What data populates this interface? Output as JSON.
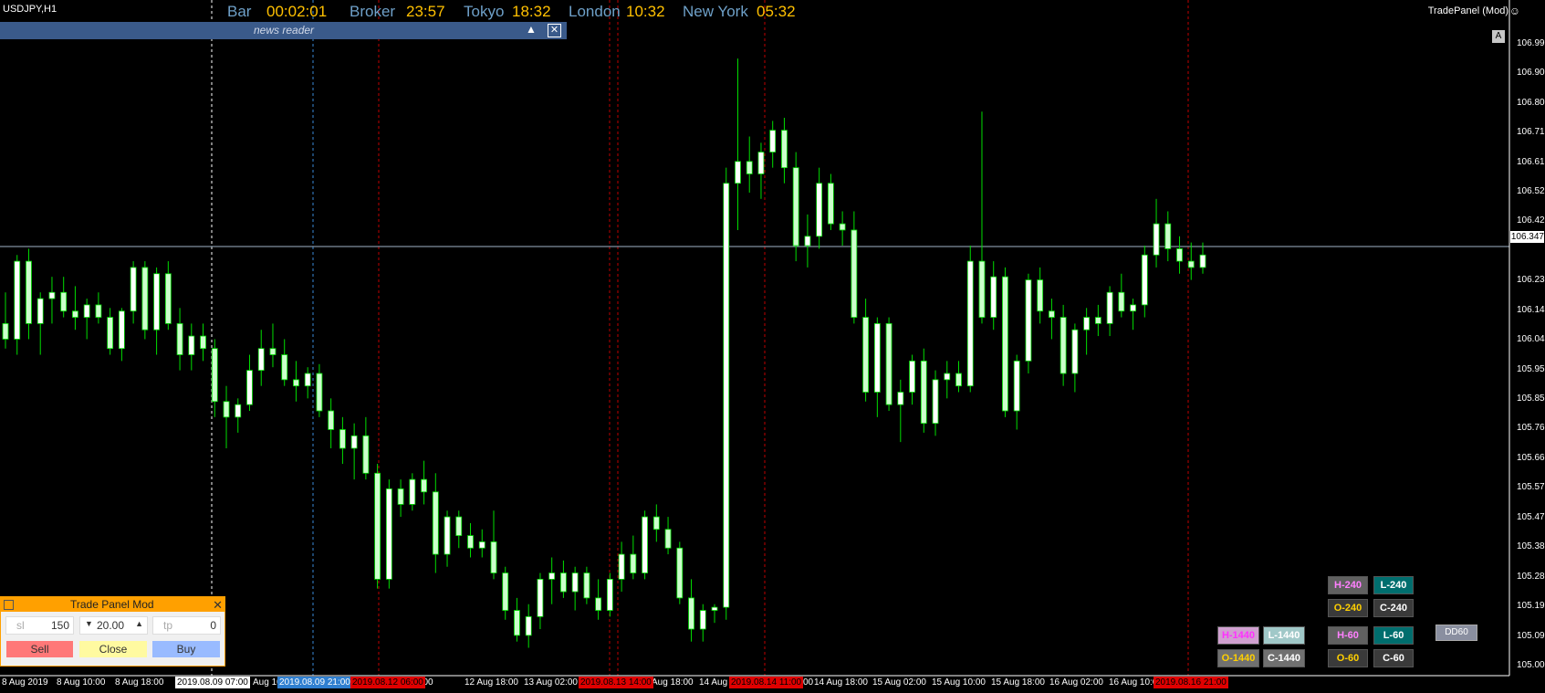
{
  "window": {
    "symbol": "USDJPY,H1"
  },
  "clock": {
    "bar_label": "Bar",
    "bar_value": "00:02:01",
    "broker_label": "Broker",
    "broker_value": "23:57",
    "tokyo_label": "Tokyo",
    "tokyo_value": "18:32",
    "london_label": "London",
    "london_value": "10:32",
    "newyork_label": "New York",
    "newyork_value": "05:32"
  },
  "indicator_title": "TradePanel (Mod)",
  "autoscroll_label": "A",
  "news_reader": {
    "title": "news reader"
  },
  "price_axis": {
    "labels": [
      "106.995",
      "106.900",
      "106.805",
      "106.710",
      "106.615",
      "106.520",
      "106.425",
      "106.235",
      "106.140",
      "106.045",
      "105.950",
      "105.855",
      "105.760",
      "105.665",
      "105.570",
      "105.475",
      "105.380",
      "105.285",
      "105.190",
      "105.095",
      "105.000"
    ],
    "current_price": "106.347"
  },
  "time_axis": {
    "labels": [
      "8 Aug 2019",
      "8 Aug 10:00",
      "8 Aug 18:00",
      "Aug 10:00",
      "Aug 10:00",
      "12 Aug 18:00",
      "13 Aug 02:00",
      "Aug 18:00",
      "14 Aug",
      "00",
      "14 Aug 18:00",
      "15 Aug 02:00",
      "15 Aug 10:00",
      "15 Aug 18:00",
      "16 Aug 02:00",
      "16 Aug 10:00"
    ],
    "highlighted": [
      "2019.08.09 07:00",
      "2019.08.09 21:00",
      "2019.08.12 06:00",
      "2019.08.13 14:00",
      "2019.08.14 11:00",
      "2019.08.16 21:00"
    ]
  },
  "trade_panel": {
    "title": "Trade Panel Mod",
    "sl_placeholder": "sl",
    "sl_value": "150",
    "lot_value": "20.00",
    "tp_placeholder": "tp",
    "tp_value": "0",
    "sell_label": "Sell",
    "close_label": "Close",
    "buy_label": "Buy"
  },
  "levels": {
    "h240": "H-240",
    "l240": "L-240",
    "o240": "O-240",
    "c240": "C-240",
    "h1440": "H-1440",
    "l1440": "L-1440",
    "o1440": "O-1440",
    "c1440": "C-1440",
    "h60": "H-60",
    "l60": "L-60",
    "o60": "O-60",
    "c60": "C-60",
    "dd60": "DD60"
  },
  "colors": {
    "background": "#000000",
    "candle_bull": "#ffffff",
    "candle_bear": "#ccffcc",
    "wick": "#00dd00",
    "clock_label": "#6ea0c8",
    "clock_value": "#ffc000",
    "separator_red": "#c00000",
    "panel_accent": "#ffa000"
  },
  "chart_data": {
    "type": "candlestick",
    "ylim": [
      105.0,
      107.05
    ],
    "current_price": 106.347,
    "ohlc": [
      [
        106.1,
        106.2,
        106.02,
        106.05
      ],
      [
        106.05,
        106.32,
        106.0,
        106.3
      ],
      [
        106.3,
        106.34,
        106.05,
        106.1
      ],
      [
        106.1,
        106.2,
        106.0,
        106.18
      ],
      [
        106.18,
        106.25,
        106.1,
        106.2
      ],
      [
        106.2,
        106.25,
        106.12,
        106.14
      ],
      [
        106.14,
        106.22,
        106.08,
        106.12
      ],
      [
        106.12,
        106.18,
        106.05,
        106.16
      ],
      [
        106.16,
        106.2,
        106.1,
        106.12
      ],
      [
        106.12,
        106.15,
        106.0,
        106.02
      ],
      [
        106.02,
        106.15,
        105.98,
        106.14
      ],
      [
        106.14,
        106.3,
        106.1,
        106.28
      ],
      [
        106.28,
        106.3,
        106.05,
        106.08
      ],
      [
        106.08,
        106.28,
        106.0,
        106.26
      ],
      [
        106.26,
        106.3,
        106.08,
        106.1
      ],
      [
        106.1,
        106.15,
        105.95,
        106.0
      ],
      [
        106.0,
        106.1,
        105.95,
        106.06
      ],
      [
        106.06,
        106.1,
        105.98,
        106.02
      ],
      [
        106.02,
        106.05,
        105.8,
        105.85
      ],
      [
        105.85,
        105.9,
        105.7,
        105.8
      ],
      [
        105.8,
        105.86,
        105.75,
        105.84
      ],
      [
        105.84,
        106.0,
        105.82,
        105.95
      ],
      [
        105.95,
        106.08,
        105.9,
        106.02
      ],
      [
        106.02,
        106.1,
        105.96,
        106.0
      ],
      [
        106.0,
        106.05,
        105.9,
        105.92
      ],
      [
        105.92,
        105.98,
        105.85,
        105.9
      ],
      [
        105.9,
        105.96,
        105.86,
        105.94
      ],
      [
        105.94,
        105.97,
        105.8,
        105.82
      ],
      [
        105.82,
        105.86,
        105.7,
        105.76
      ],
      [
        105.76,
        105.8,
        105.65,
        105.7
      ],
      [
        105.7,
        105.78,
        105.6,
        105.74
      ],
      [
        105.74,
        105.8,
        105.6,
        105.62
      ],
      [
        105.62,
        105.65,
        105.25,
        105.28
      ],
      [
        105.28,
        105.6,
        105.25,
        105.57
      ],
      [
        105.57,
        105.6,
        105.48,
        105.52
      ],
      [
        105.52,
        105.62,
        105.5,
        105.6
      ],
      [
        105.6,
        105.66,
        105.52,
        105.56
      ],
      [
        105.56,
        105.62,
        105.3,
        105.36
      ],
      [
        105.36,
        105.5,
        105.32,
        105.48
      ],
      [
        105.48,
        105.5,
        105.38,
        105.42
      ],
      [
        105.42,
        105.46,
        105.35,
        105.38
      ],
      [
        105.38,
        105.44,
        105.35,
        105.4
      ],
      [
        105.4,
        105.5,
        105.28,
        105.3
      ],
      [
        105.3,
        105.32,
        105.15,
        105.18
      ],
      [
        105.18,
        105.22,
        105.08,
        105.1
      ],
      [
        105.1,
        105.2,
        105.06,
        105.16
      ],
      [
        105.16,
        105.3,
        105.12,
        105.28
      ],
      [
        105.28,
        105.35,
        105.2,
        105.3
      ],
      [
        105.3,
        105.34,
        105.22,
        105.24
      ],
      [
        105.24,
        105.32,
        105.18,
        105.3
      ],
      [
        105.3,
        105.32,
        105.2,
        105.22
      ],
      [
        105.22,
        105.28,
        105.15,
        105.18
      ],
      [
        105.18,
        105.3,
        105.16,
        105.28
      ],
      [
        105.28,
        105.4,
        105.24,
        105.36
      ],
      [
        105.36,
        105.42,
        105.28,
        105.3
      ],
      [
        105.3,
        105.5,
        105.28,
        105.48
      ],
      [
        105.48,
        105.52,
        105.4,
        105.44
      ],
      [
        105.44,
        105.48,
        105.36,
        105.38
      ],
      [
        105.38,
        105.4,
        105.2,
        105.22
      ],
      [
        105.22,
        105.28,
        105.08,
        105.12
      ],
      [
        105.12,
        105.2,
        105.08,
        105.18
      ],
      [
        105.18,
        105.2,
        105.14,
        105.19
      ],
      [
        105.19,
        106.6,
        105.15,
        106.55
      ],
      [
        106.55,
        106.95,
        106.4,
        106.62
      ],
      [
        106.62,
        106.7,
        106.52,
        106.58
      ],
      [
        106.58,
        106.68,
        106.5,
        106.65
      ],
      [
        106.65,
        106.75,
        106.6,
        106.72
      ],
      [
        106.72,
        106.76,
        106.55,
        106.6
      ],
      [
        106.6,
        106.65,
        106.3,
        106.35
      ],
      [
        106.35,
        106.45,
        106.28,
        106.38
      ],
      [
        106.38,
        106.6,
        106.34,
        106.55
      ],
      [
        106.55,
        106.58,
        106.4,
        106.42
      ],
      [
        106.42,
        106.46,
        106.35,
        106.4
      ],
      [
        106.4,
        106.46,
        106.1,
        106.12
      ],
      [
        106.12,
        106.18,
        105.85,
        105.88
      ],
      [
        105.88,
        106.12,
        105.8,
        106.1
      ],
      [
        106.1,
        106.12,
        105.82,
        105.84
      ],
      [
        105.84,
        105.92,
        105.72,
        105.88
      ],
      [
        105.88,
        106.0,
        105.84,
        105.98
      ],
      [
        105.98,
        106.02,
        105.75,
        105.78
      ],
      [
        105.78,
        105.95,
        105.74,
        105.92
      ],
      [
        105.92,
        105.98,
        105.86,
        105.94
      ],
      [
        105.94,
        105.98,
        105.88,
        105.9
      ],
      [
        105.9,
        106.35,
        105.88,
        106.3
      ],
      [
        106.3,
        106.78,
        106.1,
        106.12
      ],
      [
        106.12,
        106.3,
        106.08,
        106.25
      ],
      [
        106.25,
        106.28,
        105.8,
        105.82
      ],
      [
        105.82,
        106.0,
        105.76,
        105.98
      ],
      [
        105.98,
        106.26,
        105.94,
        106.24
      ],
      [
        106.24,
        106.28,
        106.1,
        106.14
      ],
      [
        106.14,
        106.18,
        106.05,
        106.12
      ],
      [
        106.12,
        106.16,
        105.9,
        105.94
      ],
      [
        105.94,
        106.1,
        105.88,
        106.08
      ],
      [
        106.08,
        106.15,
        106.0,
        106.12
      ],
      [
        106.12,
        106.16,
        106.06,
        106.1
      ],
      [
        106.1,
        106.22,
        106.06,
        106.2
      ],
      [
        106.2,
        106.26,
        106.12,
        106.14
      ],
      [
        106.14,
        106.18,
        106.08,
        106.16
      ],
      [
        106.16,
        106.35,
        106.12,
        106.32
      ],
      [
        106.32,
        106.5,
        106.28,
        106.42
      ],
      [
        106.42,
        106.46,
        106.3,
        106.34
      ],
      [
        106.34,
        106.38,
        106.26,
        106.3
      ],
      [
        106.3,
        106.36,
        106.24,
        106.28
      ],
      [
        106.28,
        106.36,
        106.26,
        106.32
      ]
    ]
  }
}
